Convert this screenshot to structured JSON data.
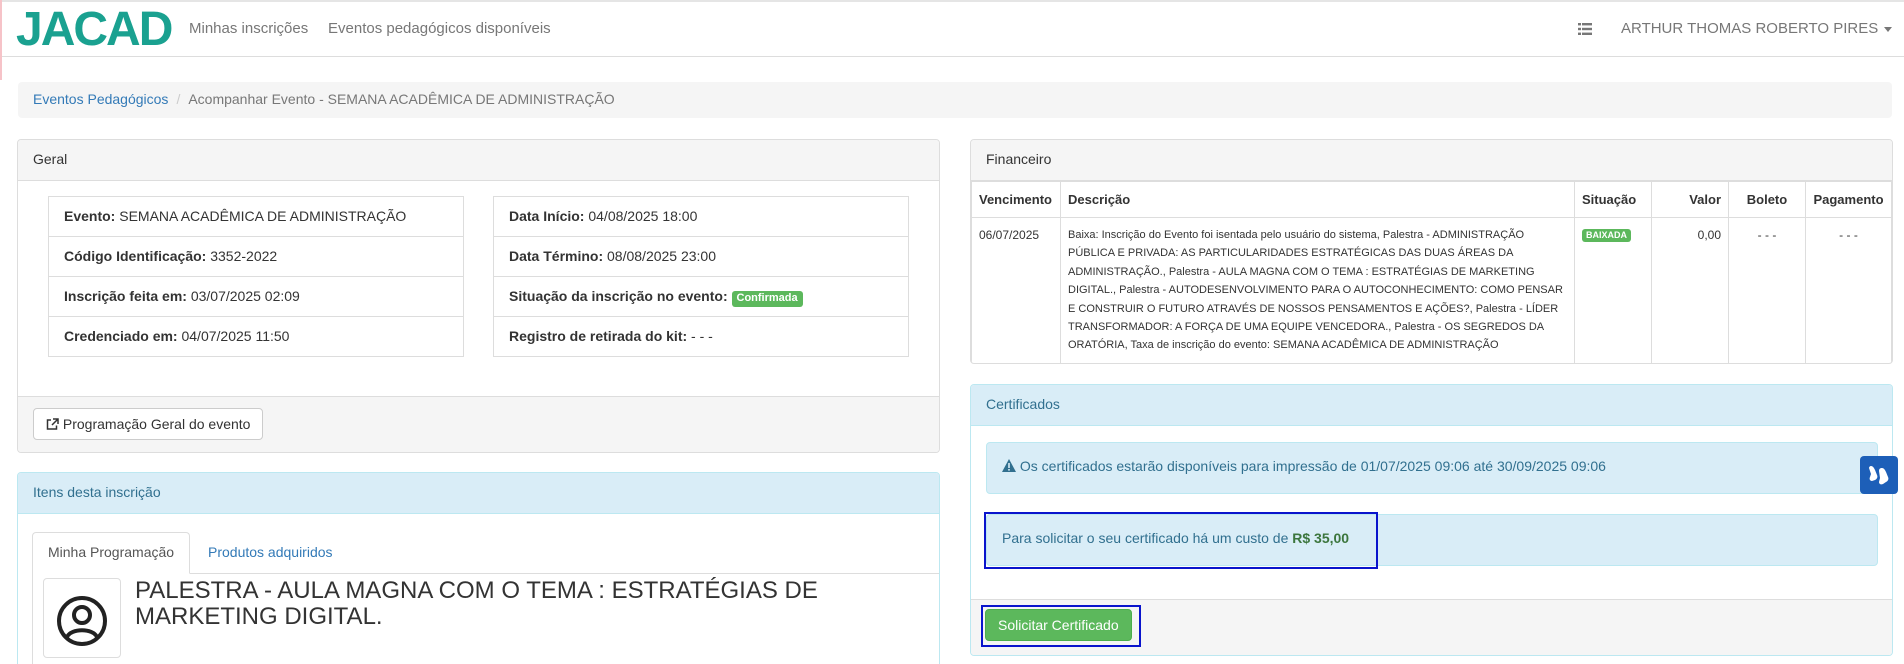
{
  "brand": "JACAD",
  "nav": {
    "items": [
      "Minhas inscrições",
      "Eventos pedagógicos disponíveis"
    ],
    "user": "ARTHUR THOMAS ROBERTO PIRES"
  },
  "breadcrumb": {
    "link": "Eventos Pedagógicos",
    "current": "Acompanhar Evento - SEMANA ACADÊMICA DE ADMINISTRAÇÃO"
  },
  "geral": {
    "title": "Geral",
    "left": [
      {
        "label": "Evento:",
        "value": "SEMANA ACADÊMICA DE ADMINISTRAÇÃO"
      },
      {
        "label": "Código Identificação:",
        "value": "3352-2022"
      },
      {
        "label": "Inscrição feita em:",
        "value": "03/07/2025 02:09"
      },
      {
        "label": "Credenciado em:",
        "value": "04/07/2025 11:50"
      }
    ],
    "right": [
      {
        "label": "Data Início:",
        "value": "04/08/2025 18:00"
      },
      {
        "label": "Data Término:",
        "value": "08/08/2025 23:00"
      },
      {
        "label": "Situação da inscrição no evento:",
        "badge": "Confirmada"
      },
      {
        "label": "Registro de retirada do kit:",
        "value": "- - -"
      }
    ],
    "button": "Programação Geral do evento"
  },
  "itens": {
    "title": "Itens desta inscrição",
    "tabs": [
      "Minha Programação",
      "Produtos adquiridos"
    ],
    "activity_title": "PALESTRA - AULA MAGNA COM O TEMA : ESTRATÉGIAS DE MARKETING DIGITAL."
  },
  "financeiro": {
    "title": "Financeiro",
    "headers": [
      "Vencimento",
      "Descrição",
      "Situação",
      "Valor",
      "Boleto",
      "Pagamento"
    ],
    "rows": [
      {
        "vencimento": "06/07/2025",
        "descricao": "Baixa: Inscrição do Evento foi isentada pelo usuário do sistema, Palestra - ADMINISTRAÇÃO PÚBLICA E PRIVADA: AS PARTICULARIDADES ESTRATÉGICAS DAS DUAS ÁREAS DA ADMINISTRAÇÃO., Palestra - AULA MAGNA COM O TEMA : ESTRATÉGIAS DE MARKETING DIGITAL., Palestra - AUTODESENVOLVIMENTO PARA O AUTOCONHECIMENTO: COMO PENSAR E CONSTRUIR O FUTURO ATRAVÉS DE NOSSOS PENSAMENTOS E AÇÕES?, Palestra - LÍDER TRANSFORMADOR: A FORÇA DE UMA EQUIPE VENCEDORA., Palestra - OS SEGREDOS DA ORATÓRIA, Taxa de inscrição do evento: SEMANA ACADÊMICA DE ADMINISTRAÇÃO",
        "situacao": "BAIXADA",
        "valor": "0,00",
        "boleto": "- - -",
        "pagamento": "- - -"
      }
    ]
  },
  "certificados": {
    "title": "Certificados",
    "availability": "Os certificados estarão disponíveis para impressão de 01/07/2025 09:06 até 30/09/2025 09:06",
    "cost_text": "Para solicitar o seu certificado há um custo de",
    "cost_value": "R$ 35,00",
    "button": "Solicitar Certificado"
  },
  "colors": {
    "brand": "#1aa190",
    "success": "#5cb85c",
    "highlight": "#0a14cc",
    "info_bg": "#d9edf7"
  }
}
